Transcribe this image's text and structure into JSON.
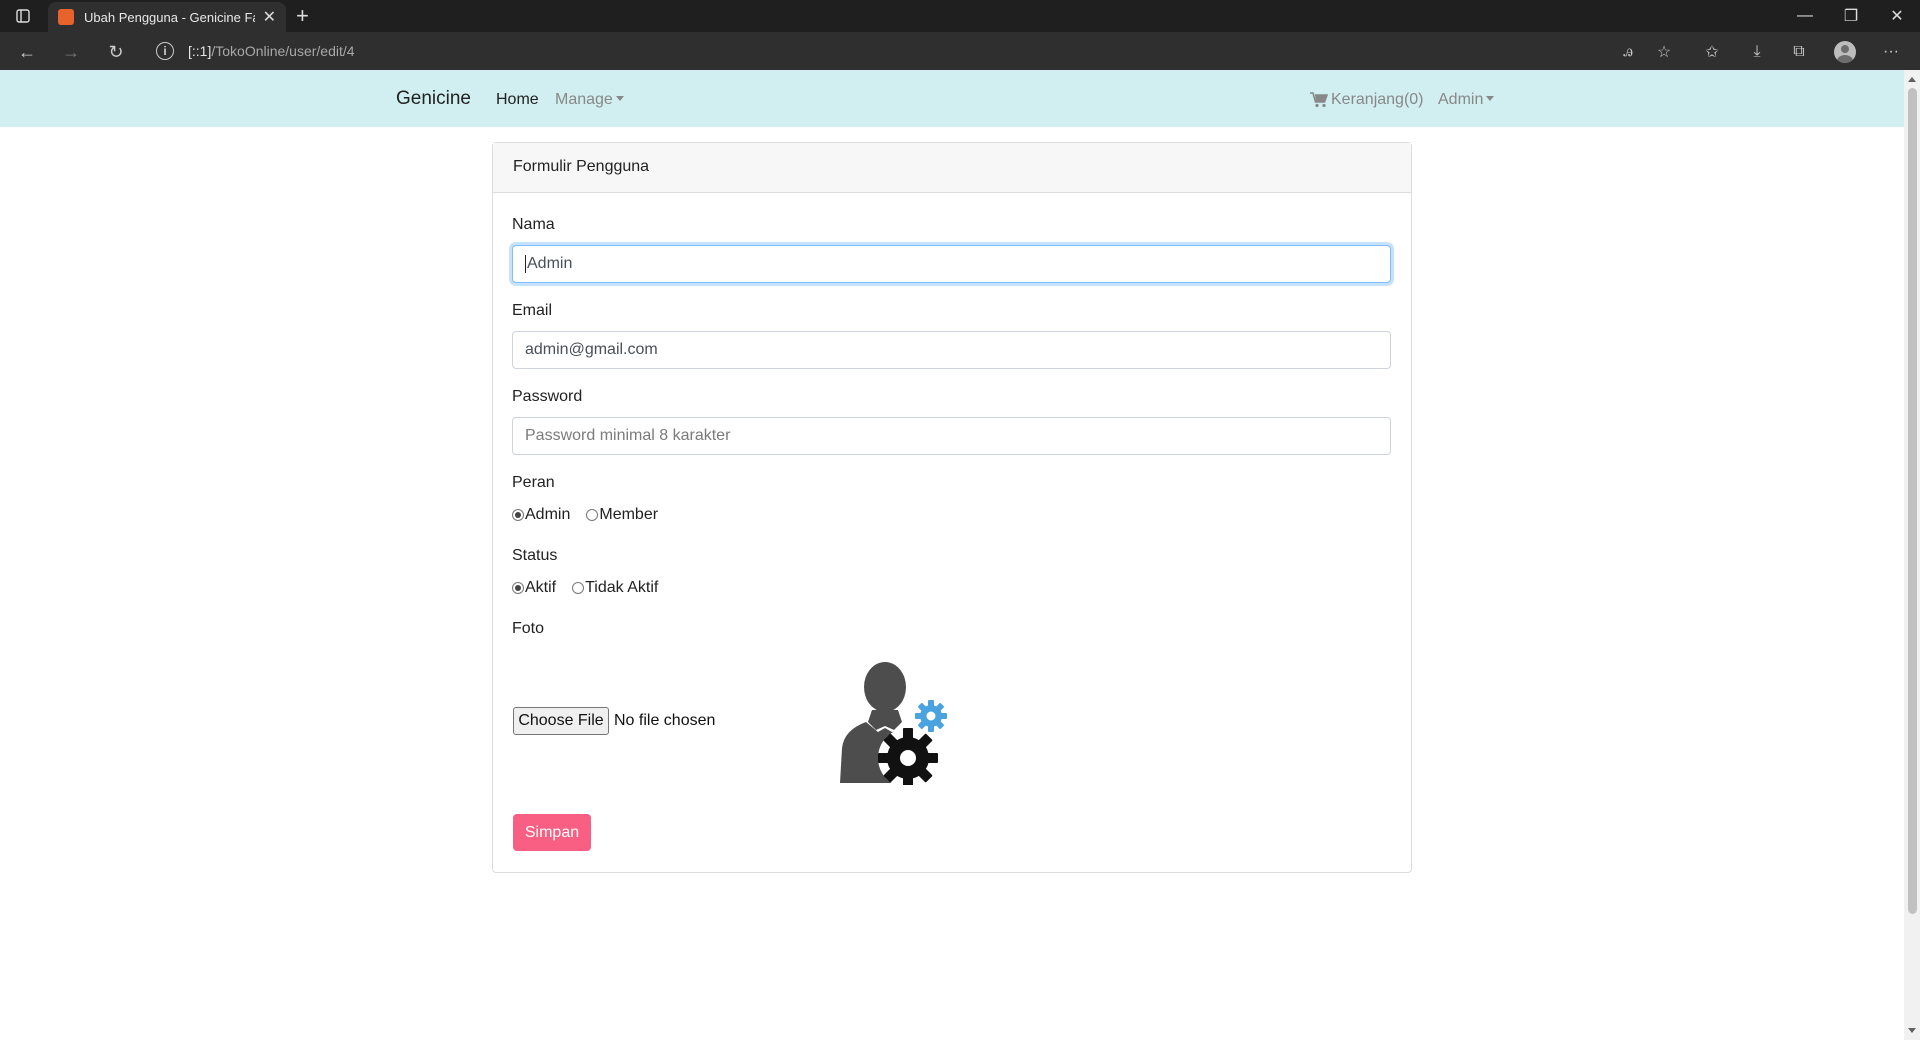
{
  "browser": {
    "tab_title": "Ubah Pengguna - Genicine Fashion",
    "url_host": "[::1]",
    "url_path": "/TokoOnline/user/edit/4"
  },
  "navbar": {
    "brand": "Genicine",
    "home": "Home",
    "manage": "Manage",
    "cart": "Keranjang(0)",
    "user_menu": "Admin"
  },
  "form": {
    "header": "Formulir Pengguna",
    "name_label": "Nama",
    "name_value": "Admin",
    "email_label": "Email",
    "email_value": "admin@gmail.com",
    "password_label": "Password",
    "password_placeholder": "Password minimal 8 karakter",
    "role_label": "Peran",
    "role_options": [
      "Admin",
      "Member"
    ],
    "role_selected": "Admin",
    "status_label": "Status",
    "status_options": [
      "Aktif",
      "Tidak Aktif"
    ],
    "status_selected": "Aktif",
    "photo_label": "Foto",
    "file_button": "Choose File",
    "file_status": "No file chosen",
    "submit": "Simpan"
  },
  "colors": {
    "navbar_bg": "#d1eff0",
    "submit_bg": "#f85f82",
    "gear_blue": "#4aa3df"
  }
}
